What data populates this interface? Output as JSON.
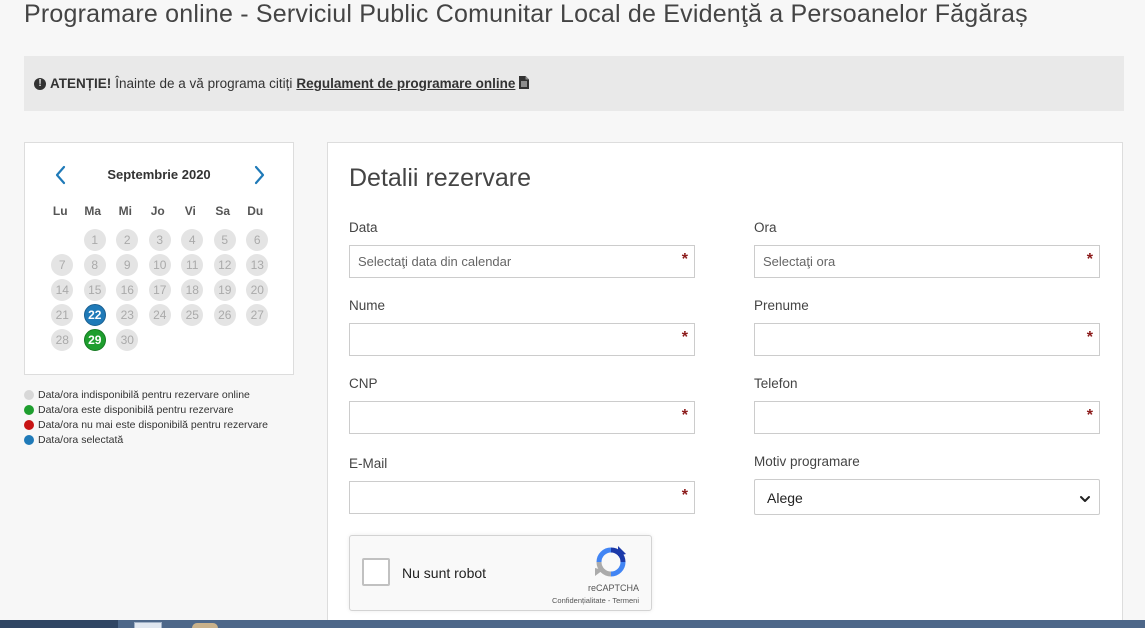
{
  "page": {
    "title": "Programare online - Serviciul Public Comunitar Local de Evidenţă a Persoanelor Făgăraș"
  },
  "alert": {
    "icon": "exclamation-circle-icon",
    "strong": "ATENȚIE!",
    "text": "Înainte de a vă programa citiți",
    "link": "Regulament de programare online",
    "link_icon": "document-icon"
  },
  "calendar": {
    "month": "Septembrie 2020",
    "prev_icon": "chevron-left-icon",
    "next_icon": "chevron-right-icon",
    "weekdays": [
      "Lu",
      "Ma",
      "Mi",
      "Jo",
      "Vi",
      "Sa",
      "Du"
    ],
    "weeks": [
      [
        {
          "d": "",
          "s": "empty"
        },
        {
          "d": "1",
          "s": "unavailable"
        },
        {
          "d": "2",
          "s": "unavailable"
        },
        {
          "d": "3",
          "s": "unavailable"
        },
        {
          "d": "4",
          "s": "unavailable"
        },
        {
          "d": "5",
          "s": "unavailable"
        },
        {
          "d": "6",
          "s": "unavailable"
        }
      ],
      [
        {
          "d": "7",
          "s": "unavailable"
        },
        {
          "d": "8",
          "s": "unavailable"
        },
        {
          "d": "9",
          "s": "unavailable"
        },
        {
          "d": "10",
          "s": "unavailable"
        },
        {
          "d": "11",
          "s": "unavailable"
        },
        {
          "d": "12",
          "s": "unavailable"
        },
        {
          "d": "13",
          "s": "unavailable"
        }
      ],
      [
        {
          "d": "14",
          "s": "unavailable"
        },
        {
          "d": "15",
          "s": "unavailable"
        },
        {
          "d": "16",
          "s": "unavailable"
        },
        {
          "d": "17",
          "s": "unavailable"
        },
        {
          "d": "18",
          "s": "unavailable"
        },
        {
          "d": "19",
          "s": "unavailable"
        },
        {
          "d": "20",
          "s": "unavailable"
        }
      ],
      [
        {
          "d": "21",
          "s": "unavailable"
        },
        {
          "d": "22",
          "s": "selected"
        },
        {
          "d": "23",
          "s": "unavailable"
        },
        {
          "d": "24",
          "s": "unavailable"
        },
        {
          "d": "25",
          "s": "unavailable"
        },
        {
          "d": "26",
          "s": "unavailable"
        },
        {
          "d": "27",
          "s": "unavailable"
        }
      ],
      [
        {
          "d": "28",
          "s": "unavailable"
        },
        {
          "d": "29",
          "s": "available"
        },
        {
          "d": "30",
          "s": "unavailable"
        },
        {
          "d": "",
          "s": "empty"
        },
        {
          "d": "",
          "s": "empty"
        },
        {
          "d": "",
          "s": "empty"
        },
        {
          "d": "",
          "s": "empty"
        }
      ]
    ]
  },
  "legend": [
    {
      "color": "#d8d8d8",
      "text": "Data/ora indisponibilă pentru rezervare online"
    },
    {
      "color": "#1e9e2e",
      "text": "Data/ora este disponibilă pentru rezervare"
    },
    {
      "color": "#c81414",
      "text": "Data/ora nu mai este disponibilă pentru rezervare"
    },
    {
      "color": "#1f7ab8",
      "text": "Data/ora selectată"
    }
  ],
  "form": {
    "title": "Detalii rezervare",
    "required_mark": "*",
    "data": {
      "label": "Data",
      "placeholder": "Selectaţi data din calendar"
    },
    "ora": {
      "label": "Ora",
      "placeholder": "Selectaţi ora"
    },
    "nume": {
      "label": "Nume",
      "placeholder": ""
    },
    "prenume": {
      "label": "Prenume",
      "placeholder": ""
    },
    "cnp": {
      "label": "CNP",
      "placeholder": ""
    },
    "telefon": {
      "label": "Telefon",
      "placeholder": ""
    },
    "email": {
      "label": "E-Mail",
      "placeholder": ""
    },
    "motiv": {
      "label": "Motiv programare",
      "value": "Alege"
    }
  },
  "captcha": {
    "label": "Nu sunt robot",
    "brand": "reCAPTCHA",
    "terms": "Confidențialitate - Termeni",
    "icon": "recaptcha-icon"
  }
}
